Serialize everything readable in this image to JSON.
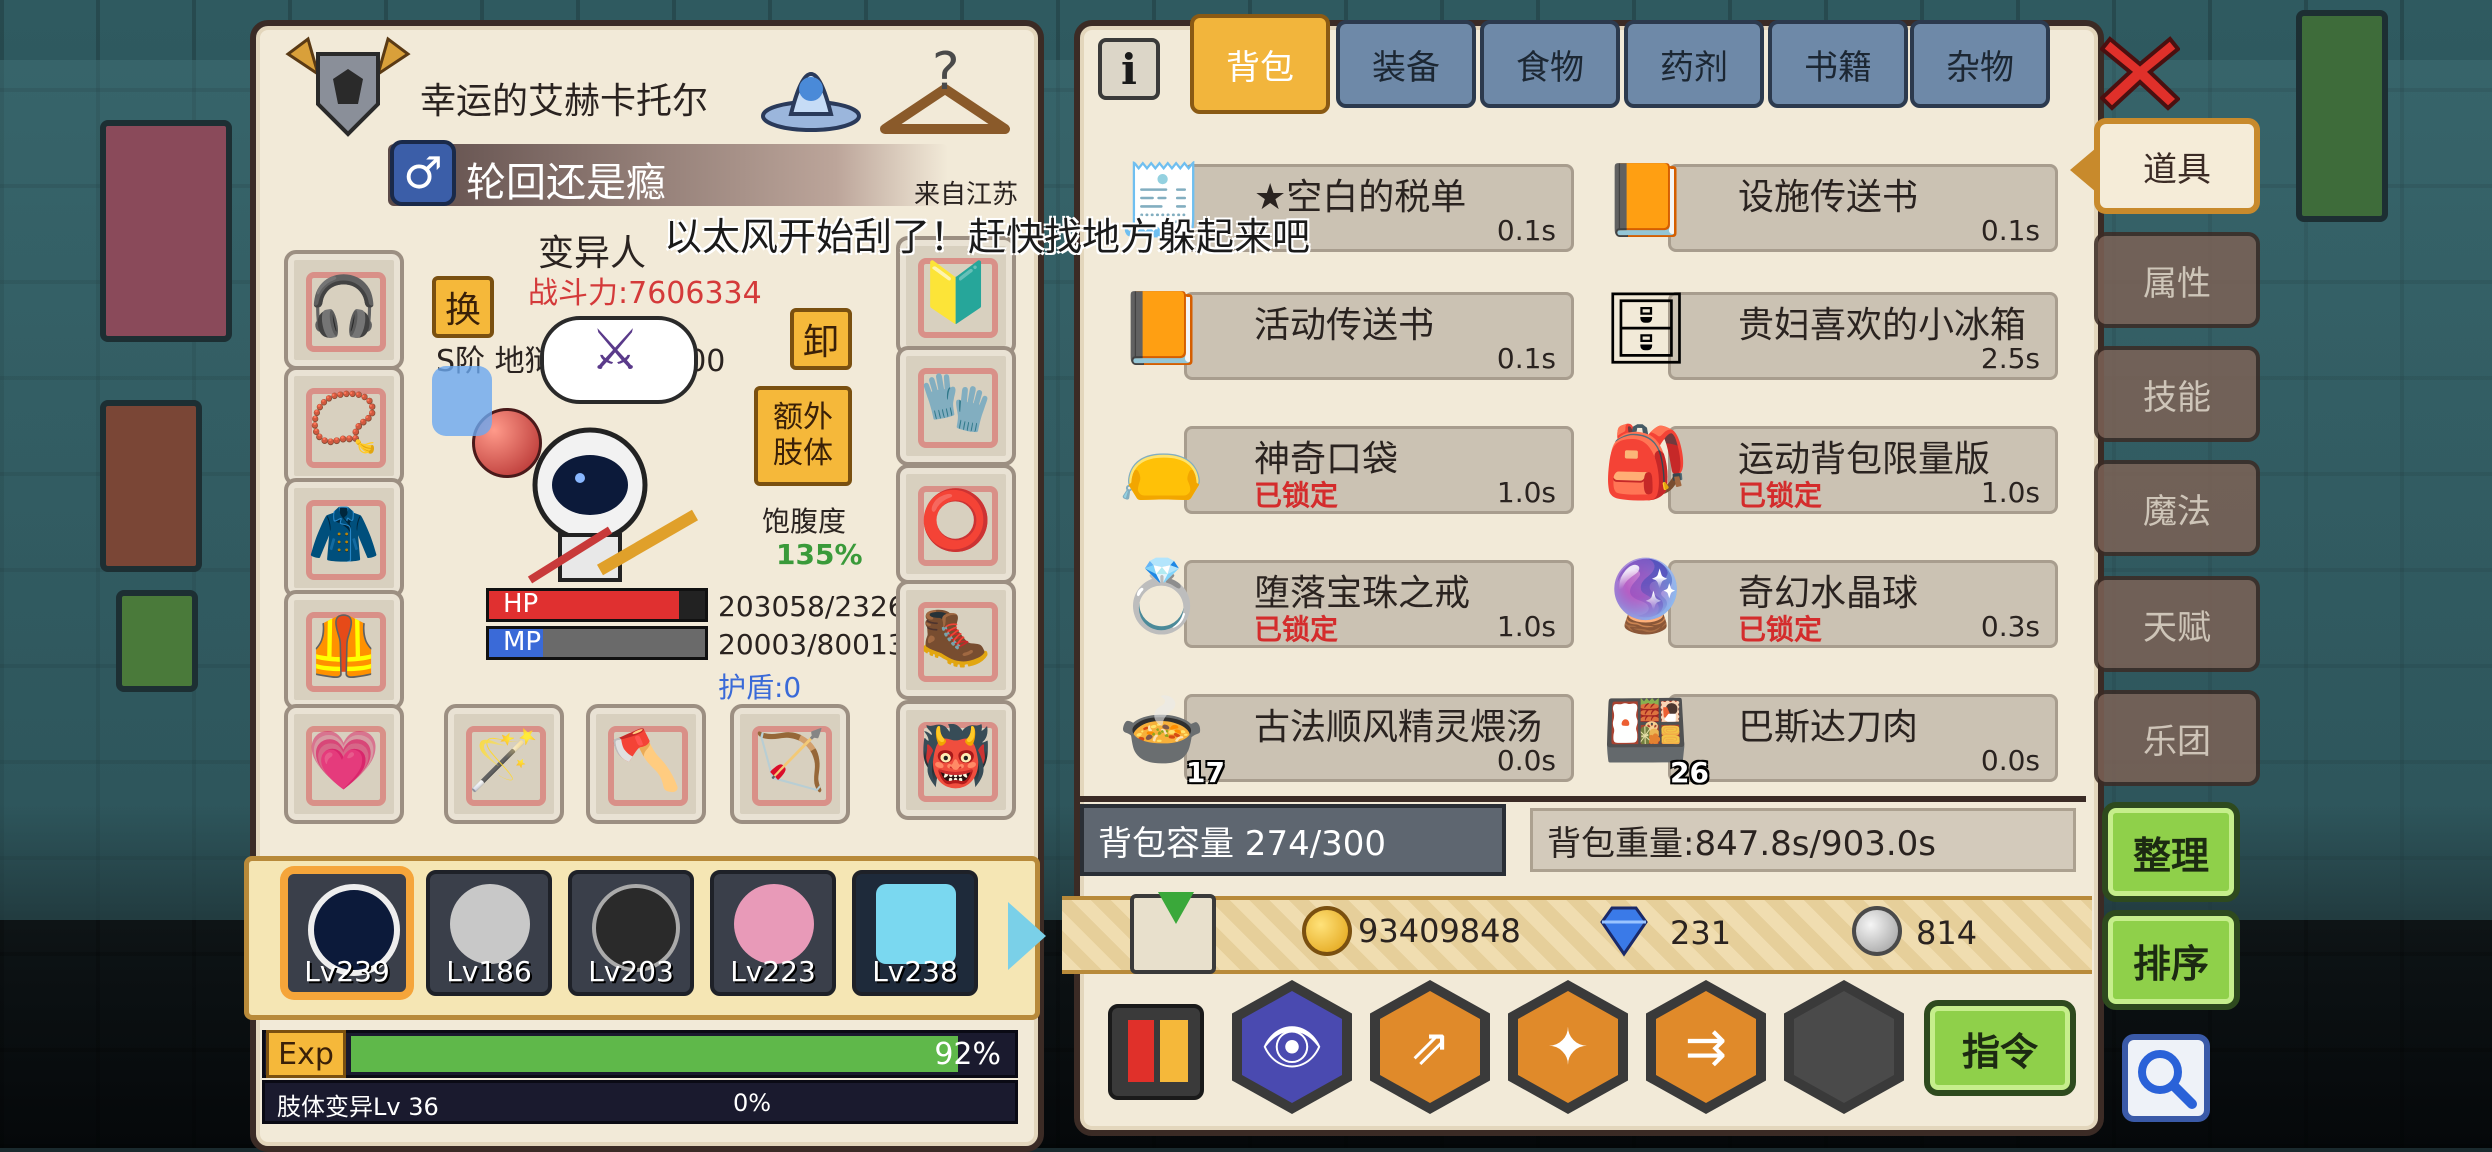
{
  "player": {
    "name": "幸运的艾赫卡托尔",
    "title": "轮回还是瘾",
    "origin": "来自江苏",
    "race": "变异人",
    "combat_power": "战斗力:7606334",
    "class_rank": "S阶 地狱使徒 Lv 100",
    "hp_label": "HP",
    "hp_value": "203058/2326",
    "mp_label": "MP",
    "mp_value": "20003/80013",
    "shield": "护盾:0",
    "satiety_label": "饱腹度",
    "satiety_value": "135%",
    "hp_fill_pct": 88,
    "mp_fill_pct": 25
  },
  "buttons": {
    "swap": "换",
    "unequip": "卸",
    "extra_limb": "额外\n肢体",
    "organize": "整理",
    "sort": "排序",
    "command": "指令"
  },
  "toast": "以太风开始刮了！赶快找地方躲起来吧",
  "tabs": [
    "背包",
    "装备",
    "食物",
    "药剂",
    "书籍",
    "杂物"
  ],
  "side_tabs": [
    "道具",
    "属性",
    "技能",
    "魔法",
    "天赋",
    "乐团"
  ],
  "items": [
    {
      "name": "★空白的税单",
      "weight": "0.1s",
      "locked": "",
      "count": ""
    },
    {
      "name": "设施传送书",
      "weight": "0.1s",
      "locked": "",
      "count": ""
    },
    {
      "name": "活动传送书",
      "weight": "0.1s",
      "locked": "",
      "count": ""
    },
    {
      "name": "贵妇喜欢的小冰箱",
      "weight": "2.5s",
      "locked": "",
      "count": ""
    },
    {
      "name": "神奇口袋",
      "weight": "1.0s",
      "locked": "已锁定",
      "count": ""
    },
    {
      "name": "运动背包限量版",
      "weight": "1.0s",
      "locked": "已锁定",
      "count": ""
    },
    {
      "name": "堕落宝珠之戒",
      "weight": "1.0s",
      "locked": "已锁定",
      "count": ""
    },
    {
      "name": "奇幻水晶球",
      "weight": "0.3s",
      "locked": "已锁定",
      "count": ""
    },
    {
      "name": "古法顺风精灵煨汤",
      "weight": "0.0s",
      "locked": "",
      "count": "17"
    },
    {
      "name": "巴斯达刀肉",
      "weight": "0.0s",
      "locked": "",
      "count": "26"
    }
  ],
  "capacity": "背包容量 274/300",
  "weight": "背包重量:847.8s/903.0s",
  "currency": {
    "gold": "93409848",
    "gems": "231",
    "silver": "814"
  },
  "heroes": [
    "Lv239",
    "Lv186",
    "Lv203",
    "Lv223",
    "Lv238"
  ],
  "exp": {
    "label": "Exp",
    "percent": "92%",
    "fill": 92
  },
  "limb": {
    "label": "肢体变异Lv 36",
    "percent": "0%",
    "fill": 0
  },
  "colors": {
    "accent": "#f2b53c",
    "panel": "#f2ead8",
    "border": "#3b2b25",
    "locked": "#d42c2c",
    "exp": "#5fb84a"
  }
}
